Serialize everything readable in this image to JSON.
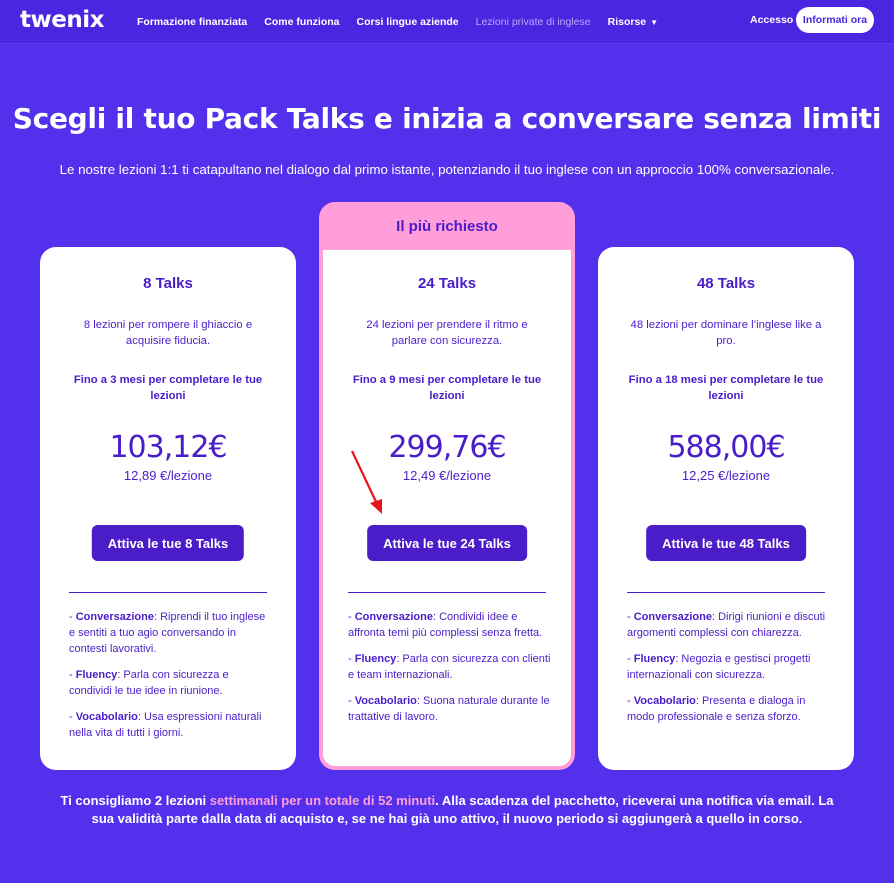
{
  "nav": {
    "logo": "twenix",
    "links": [
      {
        "label": "Formazione finanziata"
      },
      {
        "label": "Come funziona"
      },
      {
        "label": "Corsi lingue aziende"
      },
      {
        "label": "Lezioni private di inglese"
      },
      {
        "label": "Risorse"
      }
    ],
    "login": "Accesso",
    "cta": "Informati ora"
  },
  "hero": {
    "title": "Scegli il tuo Pack Talks e inizia a conversare senza limiti",
    "subtitle": "Le nostre lezioni 1:1 ti catapultano nel dialogo dal primo istante, potenziando il tuo inglese con un approccio 100% conversazionale."
  },
  "featured_label": "Il più richiesto",
  "plans": [
    {
      "title": "8 Talks",
      "desc": "8 lezioni per rompere il ghiaccio e acquisire fiducia.",
      "duration": "Fino a 3 mesi per completare le tue lezioni",
      "price": "103,12€",
      "per_lesson": "12,89 €/lezione",
      "button": "Attiva le tue 8 Talks",
      "features": [
        {
          "k": "Conversazione",
          "v": ": Riprendi il tuo inglese e sentiti a tuo agio conversando in contesti lavorativi."
        },
        {
          "k": "Fluency",
          "v": ": Parla con sicurezza e condividi le tue idee in riunione."
        },
        {
          "k": "Vocabolario",
          "v": ": Usa espressioni naturali nella vita di tutti i giorni."
        }
      ]
    },
    {
      "title": "24 Talks",
      "desc": "24 lezioni per prendere il ritmo e parlare con sicurezza.",
      "duration": "Fino a 9 mesi per completare le tue lezioni",
      "price": "299,76€",
      "per_lesson": "12,49 €/lezione",
      "button": "Attiva le tue 24 Talks",
      "features": [
        {
          "k": "Conversazione",
          "v": ": Condividi idee e affronta temi più complessi senza fretta."
        },
        {
          "k": "Fluency",
          "v": ": Parla con sicurezza con clienti e team internazionali."
        },
        {
          "k": "Vocabolario",
          "v": ": Suona naturale durante le trattative di lavoro."
        }
      ]
    },
    {
      "title": "48 Talks",
      "desc": "48 lezioni per dominare l’inglese like a pro.",
      "duration": "Fino a 18 mesi per completare le tue lezioni",
      "price": "588,00€",
      "per_lesson": "12,25 €/lezione",
      "button": "Attiva le tue 48 Talks",
      "features": [
        {
          "k": "Conversazione",
          "v": ": Dirigi riunioni e discuti argomenti complessi con chiarezza."
        },
        {
          "k": "Fluency",
          "v": ": Negozia e gestisci progetti internazionali con sicurezza."
        },
        {
          "k": "Vocabolario",
          "v": ": Presenta e dialoga in modo professionale e senza sforzo."
        }
      ]
    }
  ],
  "note": {
    "part1": "Ti consigliamo 2 lezioni ",
    "highlight": "settimanali per un totale di 52 minuti",
    "part2": ". Alla scadenza del pacchetto, riceverai una notifica via email. La sua validità parte dalla data di acquisto e, se ne hai già uno attivo, il nuovo periodo si aggiungerà a quello in corso."
  },
  "colors": {
    "background": "#5230ec",
    "primary": "#4a1dc9",
    "accent_pink": "#ff9ed8",
    "arrow": "#e8141c"
  }
}
